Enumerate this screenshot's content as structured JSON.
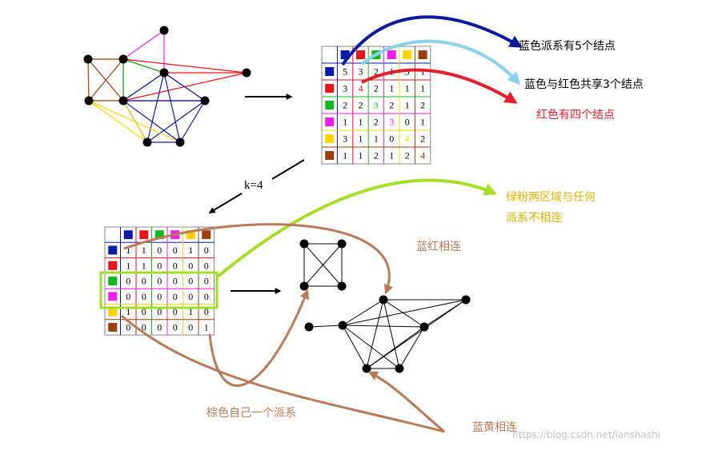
{
  "colors": {
    "blue": "#0a1aa8",
    "red": "#e8141c",
    "green": "#12b81e",
    "magenta": "#ee1ee8",
    "yellow": "#ffd200",
    "brown": "#9a3f0f",
    "arrow_dark_blue": "#0a1a9a",
    "arrow_light_blue": "#8ad2ea",
    "arrow_red": "#e41e2a",
    "arrow_lime": "#a8dc2a",
    "arrow_brown": "#b87a58",
    "highlight_lime": "#a0dc28"
  },
  "matrix1": {
    "header_colors": [
      "blue",
      "red",
      "green",
      "magenta",
      "yellow",
      "brown"
    ],
    "rows": [
      {
        "color": "blue",
        "values": [
          "5",
          "3",
          "2",
          "1",
          "3",
          "1"
        ]
      },
      {
        "color": "red",
        "values": [
          "3",
          "4",
          "2",
          "1",
          "1",
          "1"
        ]
      },
      {
        "color": "green",
        "values": [
          "2",
          "2",
          "3",
          "2",
          "1",
          "2"
        ]
      },
      {
        "color": "magenta",
        "values": [
          "1",
          "1",
          "2",
          "3",
          "0",
          "1"
        ]
      },
      {
        "color": "yellow",
        "values": [
          "3",
          "1",
          "1",
          "0",
          "4",
          "2"
        ]
      },
      {
        "color": "brown",
        "values": [
          "1",
          "1",
          "2",
          "1",
          "2",
          "4"
        ]
      }
    ]
  },
  "matrix2": {
    "header_colors": [
      "blue",
      "red",
      "green",
      "magenta",
      "yellow",
      "brown"
    ],
    "rows": [
      {
        "color": "blue",
        "values": [
          "1",
          "1",
          "0",
          "0",
          "1",
          "0"
        ]
      },
      {
        "color": "red",
        "values": [
          "1",
          "1",
          "0",
          "0",
          "0",
          "0"
        ]
      },
      {
        "color": "green",
        "values": [
          "0",
          "0",
          "0",
          "0",
          "0",
          "0"
        ]
      },
      {
        "color": "magenta",
        "values": [
          "0",
          "0",
          "0",
          "0",
          "0",
          "0"
        ]
      },
      {
        "color": "yellow",
        "values": [
          "1",
          "0",
          "0",
          "0",
          "1",
          "0"
        ]
      },
      {
        "color": "brown",
        "values": [
          "0",
          "0",
          "0",
          "0",
          "0",
          "1"
        ]
      }
    ]
  },
  "labels": {
    "blue_clique": "蓝色派系有5个结点",
    "blue_red_shared": "蓝色与红色共享3个结点",
    "red_count": "红色有四个结点",
    "k_value": "k=4",
    "green_pink_line1": "绿粉两区域与任何",
    "green_pink_line2": "派系不相连",
    "blue_red_connected": "蓝红相连",
    "brown_self": "棕色自己一个派系",
    "blue_yellow_connected": "蓝黄相连",
    "watermark": "https://blog.csdn.net/lanshashi"
  }
}
